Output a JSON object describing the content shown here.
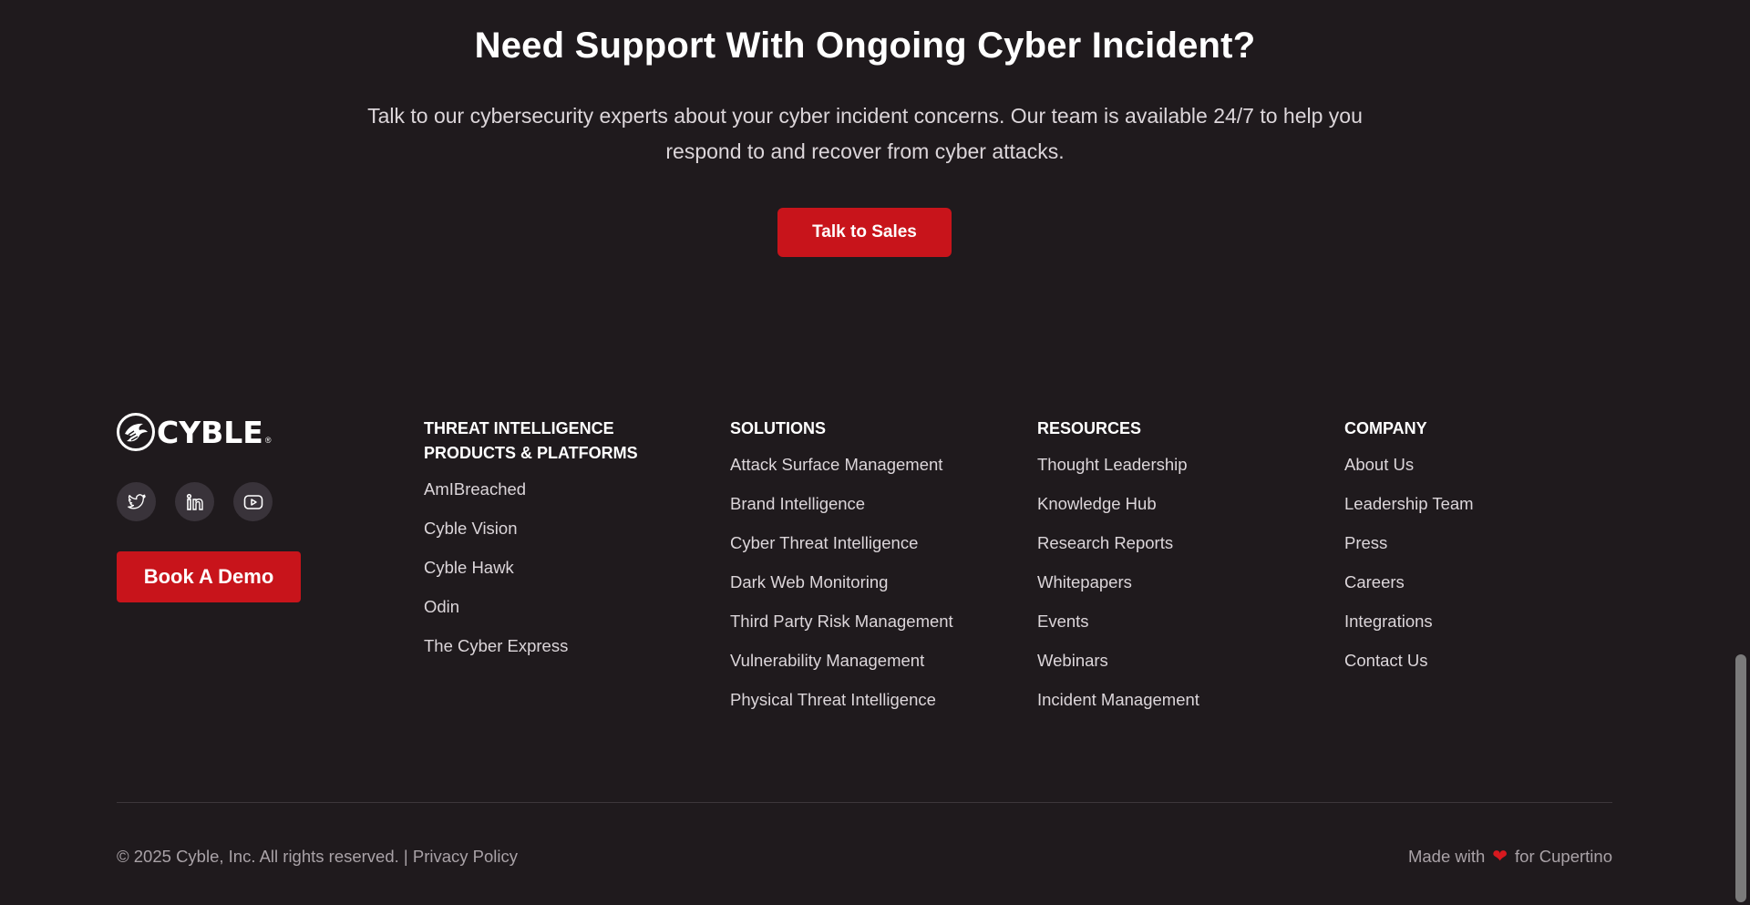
{
  "cta": {
    "title": "Need Support With Ongoing Cyber Incident?",
    "text": "Talk to our cybersecurity experts about your cyber incident concerns. Our team is available 24/7 to help you respond to and recover from cyber attacks.",
    "button_label": "Talk to Sales"
  },
  "brand": {
    "logo_text": "CYBLE",
    "logo_registered": "®",
    "socials": [
      {
        "icon": "twitter-icon"
      },
      {
        "icon": "linkedin-icon"
      },
      {
        "icon": "youtube-icon"
      }
    ],
    "demo_button_label": "Book A Demo"
  },
  "columns": [
    {
      "title": "THREAT INTELLIGENCE PRODUCTS & PLATFORMS",
      "items": [
        "AmIBreached",
        "Cyble Vision",
        "Cyble Hawk",
        "Odin",
        "The Cyber Express"
      ]
    },
    {
      "title": "SOLUTIONS",
      "items": [
        "Attack Surface Management",
        "Brand Intelligence",
        "Cyber Threat Intelligence",
        "Dark Web Monitoring",
        "Third Party Risk Management",
        "Vulnerability Management",
        "Physical Threat Intelligence"
      ]
    },
    {
      "title": "RESOURCES",
      "items": [
        "Thought Leadership",
        "Knowledge Hub",
        "Research Reports",
        "Whitepapers",
        "Events",
        "Webinars",
        "Incident Management"
      ]
    },
    {
      "title": "COMPANY",
      "items": [
        "About Us",
        "Leadership Team",
        "Press",
        "Careers",
        "Integrations",
        "Contact Us"
      ]
    }
  ],
  "bottom": {
    "copyright": "© 2025 Cyble, Inc. All rights reserved. |",
    "privacy": "Privacy Policy",
    "made_with": "Made with",
    "heart": "❤",
    "made_for": "for Cupertino"
  },
  "colors": {
    "background": "#1f1a1d",
    "accent": "#c8141b"
  }
}
